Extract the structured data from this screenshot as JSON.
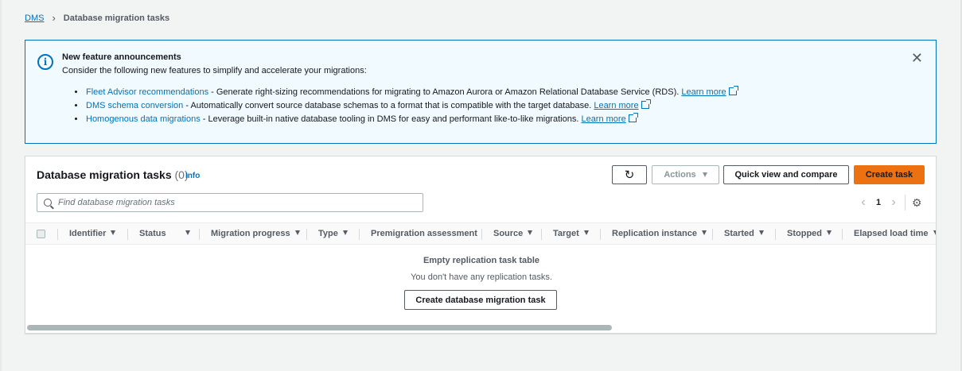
{
  "breadcrumb": {
    "root": "DMS",
    "current": "Database migration tasks"
  },
  "flash": {
    "title": "New feature announcements",
    "subtitle": "Consider the following new features to simplify and accelerate your migrations:",
    "items": [
      {
        "link": "Fleet Advisor recommendations",
        "text": " - Generate right-sizing recommendations for migrating to Amazon Aurora or Amazon Relational Database Service (RDS). ",
        "learn": "Learn more"
      },
      {
        "link": "DMS schema conversion",
        "text": " - Automatically convert source database schemas to a format that is compatible with the target database. ",
        "learn": "Learn more"
      },
      {
        "link": "Homogenous data migrations",
        "text": " - Leverage built-in native database tooling in DMS for easy and performant like-to-like migrations. ",
        "learn": "Learn more"
      }
    ],
    "close": "✕"
  },
  "table": {
    "title": "Database migration tasks",
    "count": "(0)",
    "info": "Info",
    "refresh": "↻",
    "actions": "Actions",
    "quick_view": "Quick view and compare",
    "create": "Create task",
    "search_placeholder": "Find database migration tasks",
    "page": "1",
    "columns": [
      "Identifier",
      "Status",
      "Migration progress",
      "Type",
      "Premigration assessment",
      "Source",
      "Target",
      "Replication instance",
      "Started",
      "Stopped",
      "Elapsed load time"
    ],
    "empty_title": "Empty replication task table",
    "empty_sub": "You don't have any replication tasks.",
    "empty_button": "Create database migration task"
  },
  "icons": {
    "info": "info-icon",
    "close": "close-icon",
    "refresh": "refresh-icon",
    "search": "search-icon",
    "settings": "gear-icon",
    "external": "external-link-icon"
  },
  "colors": {
    "link": "#0073bb",
    "primary_button": "#ec7211",
    "flash_bg": "#f1faff"
  }
}
